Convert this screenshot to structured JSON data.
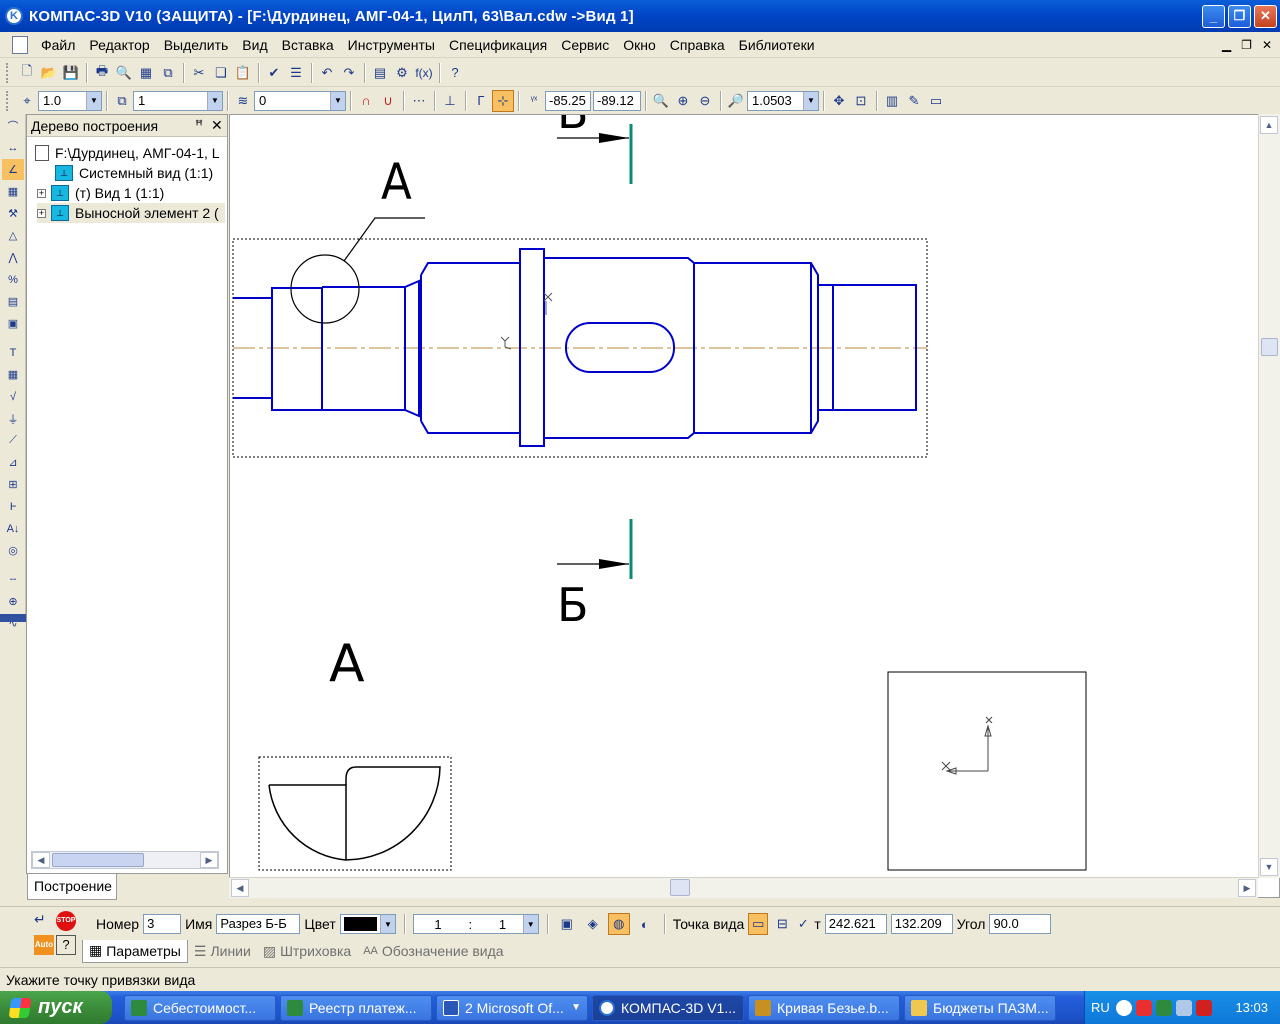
{
  "window": {
    "title": "КОМПАС-3D V10 (ЗАЩИТА) - [F:\\Дурдинец, АМГ-04-1, ЦилП, 63\\Вал.cdw ->Вид 1]",
    "app_icon_letter": "K"
  },
  "menu": [
    "Файл",
    "Редактор",
    "Выделить",
    "Вид",
    "Вставка",
    "Инструменты",
    "Спецификация",
    "Сервис",
    "Окно",
    "Справка",
    "Библиотеки"
  ],
  "toolbar2": {
    "step_value": "1.0",
    "layer_value": "1",
    "style_value": "0",
    "coord_x": "-85.25",
    "coord_y": "-89.12",
    "zoom_value": "1.0503",
    "fx_label": "f(x)"
  },
  "tree": {
    "header": "Дерево построения",
    "root": "F:\\Дурдинец, АМГ-04-1, L",
    "items": [
      "Системный вид (1:1)",
      "(т) Вид 1 (1:1)",
      "Выносной элемент 2 ("
    ],
    "tab": "Построение"
  },
  "drawing": {
    "label_a_top": "А",
    "label_b_top": "Б",
    "label_b_bottom": "Б",
    "label_a_bottom": "А"
  },
  "props": {
    "nomer_label": "Номер",
    "nomer_value": "3",
    "imya_label": "Имя",
    "imya_value": "Разрез Б-Б",
    "cvet_label": "Цвет",
    "scale_num": "1",
    "scale_sep": ":",
    "scale_den": "1",
    "tochka_label": "Точка вида",
    "t_label": "т",
    "point_x": "242.621",
    "point_y": "132.209",
    "ugol_label": "Угол",
    "ugol_value": "90.0",
    "tabs": [
      "Параметры",
      "Линии",
      "Штриховка",
      "Обозначение вида"
    ],
    "auto_label": "Auto",
    "stop_label": "STOP"
  },
  "status": "Укажите точку привязки вида",
  "taskbar": {
    "start": "пуск",
    "buttons": [
      "Себестоимост...",
      "Реестр платеж...",
      "2 Microsoft Of...",
      "КОМПАС-3D V1...",
      "Кривая Безье.b...",
      "Бюджеты ПАЗМ..."
    ],
    "lang": "RU",
    "time": "13:03"
  },
  "colors": {
    "contour": "#0000cc",
    "axis": "#c8a060",
    "section_mark": "#108878",
    "title_bar": "#0046c8"
  }
}
